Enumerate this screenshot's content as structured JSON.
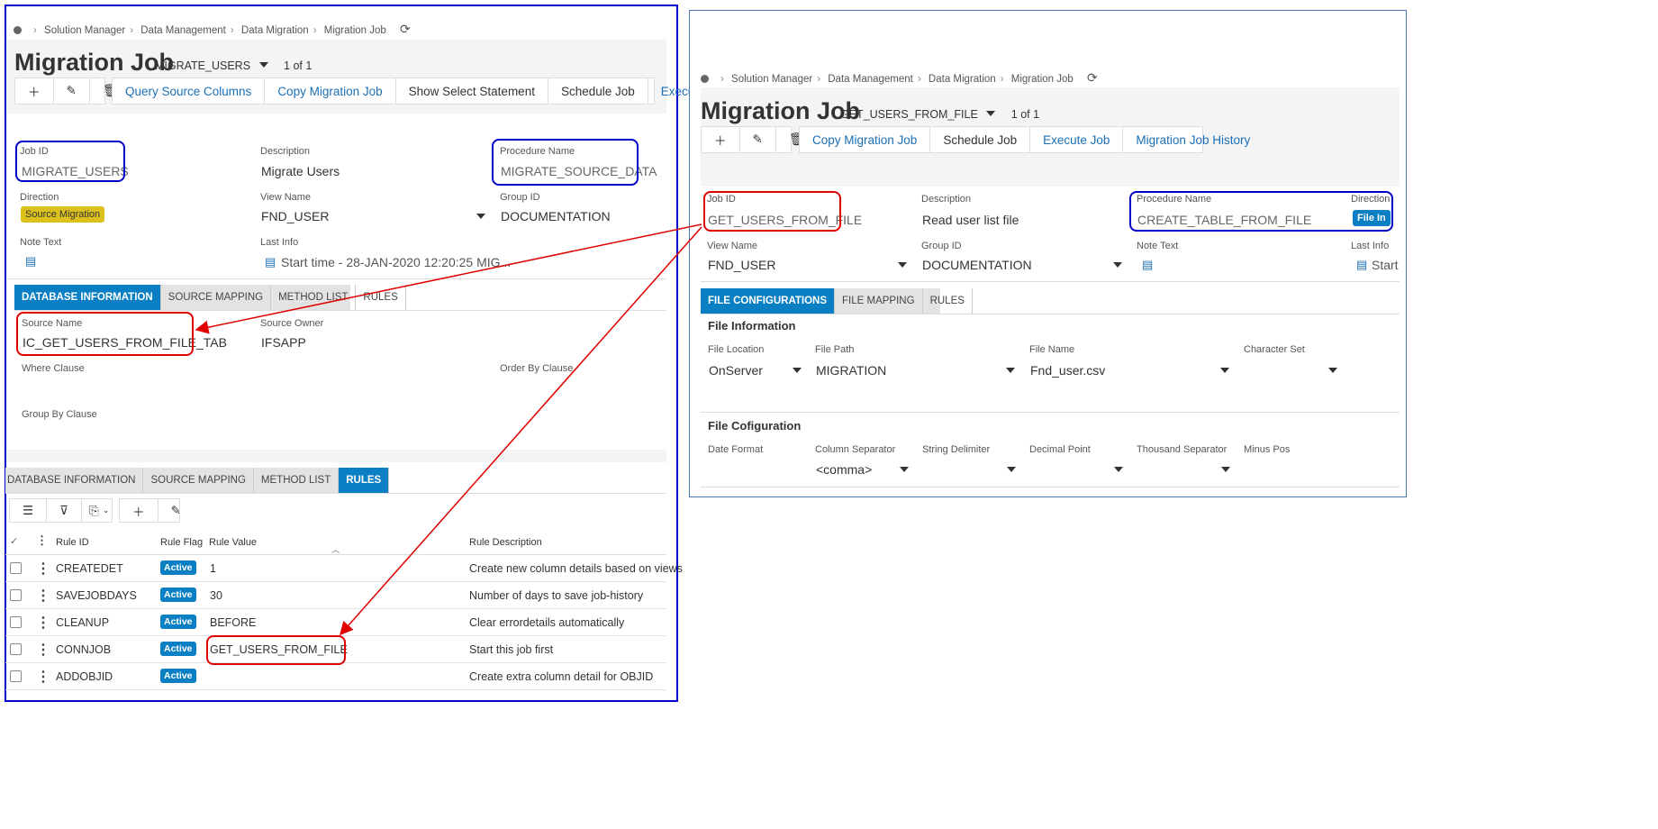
{
  "left": {
    "breadcrumb": [
      "Solution Manager",
      "Data Management",
      "Data Migration",
      "Migration Job"
    ],
    "title": "Migration Job",
    "title_key": "MIGRATE_USERS",
    "record_count": "1 of 1",
    "toolbar": {
      "query_source_columns": "Query Source Columns",
      "copy_migration_job": "Copy Migration Job",
      "show_select_statement": "Show Select Statement",
      "schedule_job": "Schedule Job",
      "execute_job": "Execute Job"
    },
    "fields": {
      "job_id_label": "Job ID",
      "job_id": "MIGRATE_USERS",
      "description_label": "Description",
      "description": "Migrate Users",
      "procedure_name_label": "Procedure Name",
      "procedure_name": "MIGRATE_SOURCE_DATA",
      "direction_label": "Direction",
      "direction": "Source Migration",
      "view_name_label": "View Name",
      "view_name": "FND_USER",
      "group_id_label": "Group ID",
      "group_id": "DOCUMENTATION",
      "note_text_label": "Note Text",
      "last_info_label": "Last Info",
      "last_info": "Start time - 28-JAN-2020 12:20:25   MIG..."
    },
    "tabs1": [
      "DATABASE INFORMATION",
      "SOURCE MAPPING",
      "METHOD LIST",
      "RULES"
    ],
    "db_info": {
      "source_name_label": "Source Name",
      "source_name": "IC_GET_USERS_FROM_FILE_TAB",
      "source_owner_label": "Source Owner",
      "source_owner": "IFSAPP",
      "where_clause_label": "Where Clause",
      "order_by_label": "Order By Clause",
      "group_by_label": "Group By Clause"
    },
    "tabs2": [
      "DATABASE INFORMATION",
      "SOURCE MAPPING",
      "METHOD LIST",
      "RULES"
    ],
    "grid_headers": {
      "rule_id": "Rule ID",
      "rule_flag": "Rule Flag",
      "rule_value": "Rule Value",
      "rule_description": "Rule Description"
    },
    "rules": [
      {
        "id": "CREATEDET",
        "flag": "Active",
        "value": "1",
        "desc": "Create new column details based on views"
      },
      {
        "id": "SAVEJOBDAYS",
        "flag": "Active",
        "value": "30",
        "desc": "Number of days to save job-history"
      },
      {
        "id": "CLEANUP",
        "flag": "Active",
        "value": "BEFORE",
        "desc": "Clear errordetails automatically"
      },
      {
        "id": "CONNJOB",
        "flag": "Active",
        "value": "GET_USERS_FROM_FILE",
        "desc": "Start this job first"
      },
      {
        "id": "ADDOBJID",
        "flag": "Active",
        "value": "",
        "desc": "Create extra column detail for OBJID"
      }
    ]
  },
  "right": {
    "breadcrumb": [
      "Solution Manager",
      "Data Management",
      "Data Migration",
      "Migration Job"
    ],
    "title": "Migration Job",
    "title_key": "GET_USERS_FROM_FILE",
    "record_count": "1 of 1",
    "toolbar": {
      "copy_migration_job": "Copy Migration Job",
      "schedule_job": "Schedule Job",
      "execute_job": "Execute Job",
      "migration_job_history": "Migration Job History"
    },
    "fields": {
      "job_id_label": "Job ID",
      "job_id": "GET_USERS_FROM_FILE",
      "description_label": "Description",
      "description": "Read user list file",
      "procedure_name_label": "Procedure Name",
      "procedure_name": "CREATE_TABLE_FROM_FILE",
      "direction_label": "Direction",
      "direction": "File In",
      "view_name_label": "View Name",
      "view_name": "FND_USER",
      "group_id_label": "Group ID",
      "group_id": "DOCUMENTATION",
      "note_text_label": "Note Text",
      "last_info_label": "Last Info",
      "last_info": "Start"
    },
    "tabs": [
      "FILE CONFIGURATIONS",
      "FILE MAPPING",
      "RULES"
    ],
    "file_info": {
      "section": "File Information",
      "file_location_label": "File Location",
      "file_location": "OnServer",
      "file_path_label": "File Path",
      "file_path": "MIGRATION",
      "file_name_label": "File Name",
      "file_name": "Fnd_user.csv",
      "character_set_label": "Character Set"
    },
    "file_config": {
      "section": "File Cofiguration",
      "date_format_label": "Date Format",
      "column_separator_label": "Column Separator",
      "column_separator": "<comma>",
      "string_delimiter_label": "String Delimiter",
      "decimal_point_label": "Decimal Point",
      "thousand_separator_label": "Thousand Separator",
      "minus_pos_label": "Minus Pos"
    }
  },
  "colors": {
    "frame": "#0000c8",
    "annotation_red": "#e00000",
    "accent": "#0a7fc4",
    "source_badge": "#dcc11c"
  }
}
